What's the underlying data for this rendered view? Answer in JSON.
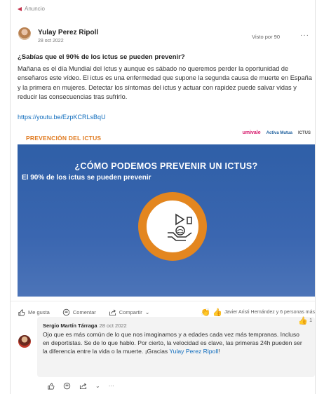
{
  "sponsored_label": "Anuncio",
  "post": {
    "author": "Yulay Perez Ripoll",
    "date": "28 oct 2022",
    "seen_by": "Visto por 90",
    "more": "···",
    "headline": "¿Sabías que el 90% de los ictus se pueden prevenir?",
    "body": "Mañana es el día Mundial del Ictus y aunque es sábado no queremos perder la oportunidad de enseñaros este vídeo. El ictus es una enfermedad que supone la segunda causa de muerte en España y la primera en mujeres. Detectar los síntomas del ictus y actuar con rapidez puede salvar vidas y reducir las consecuencias tras sufrirlo.",
    "link": "https://youtu.be/EzpKCRLsBqU"
  },
  "banner": {
    "title": "PREVENCIÓN DEL ICTUS",
    "logo_1": "umivale",
    "logo_2": "Activa Mutua",
    "logo_3": "ICTUS"
  },
  "video": {
    "title": "¿CÓMO PODEMOS PREVENIR UN ICTUS?",
    "subtitle": "El 90% de los ictus se pueden prevenir"
  },
  "actions": {
    "like": "Me gusta",
    "comment": "Comentar",
    "share": "Compartir",
    "reactions": "Javier Aristi Hernández y 6 personas más"
  },
  "comment": {
    "author": "Sergio Martín Tárraga",
    "date": "28 oct 2022",
    "text": "Ojo que es más común de lo que nos imaginamos y a edades cada vez más tempranas. Incluso en deportistas. Se de lo que hablo. Por cierto, la velocidad es clave, las primeras 24h pueden ser la diferencia entre la vida o la muerte. ¡Gracias ",
    "mention": "Yulay Perez Ripoll",
    "text_end": "!",
    "like_count": "1"
  },
  "colors": {
    "accent_orange": "#e3861f",
    "video_blue": "#2f5fa7",
    "link_blue": "#0f6cbd",
    "sponsor_red": "#c4314b"
  }
}
